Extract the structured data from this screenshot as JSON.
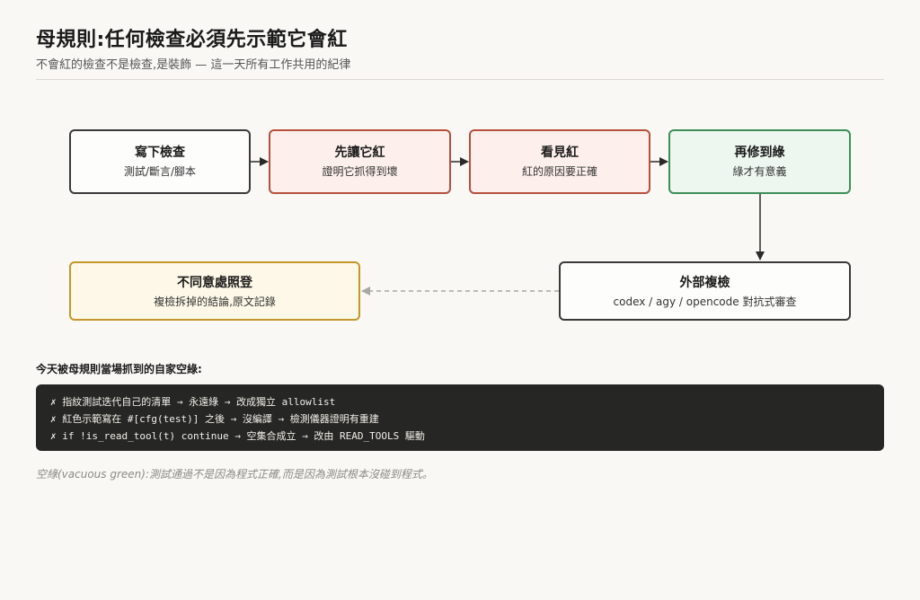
{
  "header": {
    "title": "母規則:任何檢查必須先示範它會紅",
    "subtitle": "不會紅的檢查不是檢查,是裝飾 — 這一天所有工作共用的紀律"
  },
  "flow": {
    "steps": [
      {
        "title": "寫下檢查",
        "sub": "測試/斷言/腳本",
        "style": "neutral"
      },
      {
        "title": "先讓它紅",
        "sub": "證明它抓得到壞",
        "style": "red"
      },
      {
        "title": "看見紅",
        "sub": "紅的原因要正確",
        "style": "red"
      },
      {
        "title": "再修到綠",
        "sub": "綠才有意義",
        "style": "green"
      },
      {
        "title": "外部複檢",
        "sub": "codex / agy / opencode 對抗式審查",
        "style": "neutral"
      },
      {
        "title": "不同意處照登",
        "sub": "複檢拆掉的結論,原文記錄",
        "style": "gold"
      }
    ]
  },
  "caught": {
    "label": "今天被母規則當場抓到的自家空綠:",
    "items": [
      "✗ 指紋測試迭代自己的清單 → 永遠綠 → 改成獨立 allowlist",
      "✗ 紅色示範寫在 #[cfg(test)] 之後 → 沒編譯 → 檢測儀器證明有重建",
      "✗ if !is_read_tool(t) continue → 空集合成立 → 改由 READ_TOOLS 驅動"
    ]
  },
  "footnote": "空綠(vacuous green):測試通過不是因為程式正確,而是因為測試根本沒碰到程式。",
  "colors": {
    "background": "#f9f8f5",
    "red_border": "#b5503c",
    "red_fill": "#fdf0ec",
    "green_border": "#3d8f57",
    "green_fill": "#edf6ef",
    "gold_border": "#c5962b",
    "gold_fill": "#fdf8e7",
    "code_bg": "#262624",
    "arrow": "#2a2a2a",
    "dashed_arrow": "#a8a8a4"
  }
}
